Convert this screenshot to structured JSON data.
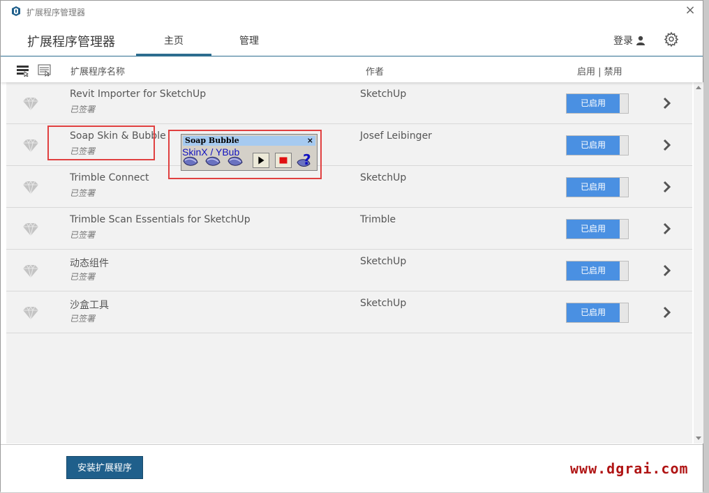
{
  "window": {
    "title": "扩展程序管理器"
  },
  "header": {
    "app_title": "扩展程序管理器",
    "tabs": [
      {
        "label": "主页",
        "active": true
      },
      {
        "label": "管理",
        "active": false
      }
    ],
    "login_label": "登录"
  },
  "columns": {
    "name": "扩展程序名称",
    "author": "作者",
    "enable": "启用 | 禁用"
  },
  "extensions": [
    {
      "name": "Revit Importer for SketchUp",
      "signed": "已签署",
      "author": "SketchUp",
      "status": "已启用"
    },
    {
      "name": "Soap Skin & Bubble",
      "signed": "已签署",
      "author": "Josef Leibinger",
      "status": "已启用"
    },
    {
      "name": "Trimble Connect",
      "signed": "已签署",
      "author": "SketchUp",
      "status": "已启用"
    },
    {
      "name": "Trimble Scan Essentials for SketchUp",
      "signed": "已签署",
      "author": "Trimble",
      "status": "已启用"
    },
    {
      "name": "动态组件",
      "signed": "已签署",
      "author": "SketchUp",
      "status": "已启用"
    },
    {
      "name": "沙盒工具",
      "signed": "已签署",
      "author": "SketchUp",
      "status": "已启用"
    }
  ],
  "toolbar": {
    "title": "Soap Bubble",
    "label": "SkinX / YBub"
  },
  "footer": {
    "install_label": "安装扩展程序",
    "watermark": "www.dgrai.com"
  },
  "colors": {
    "accent": "#2d6d8f",
    "toggle_on": "#4a90e2",
    "install_btn": "#1f5f8b",
    "watermark": "#b01414",
    "highlight": "#e04040"
  }
}
